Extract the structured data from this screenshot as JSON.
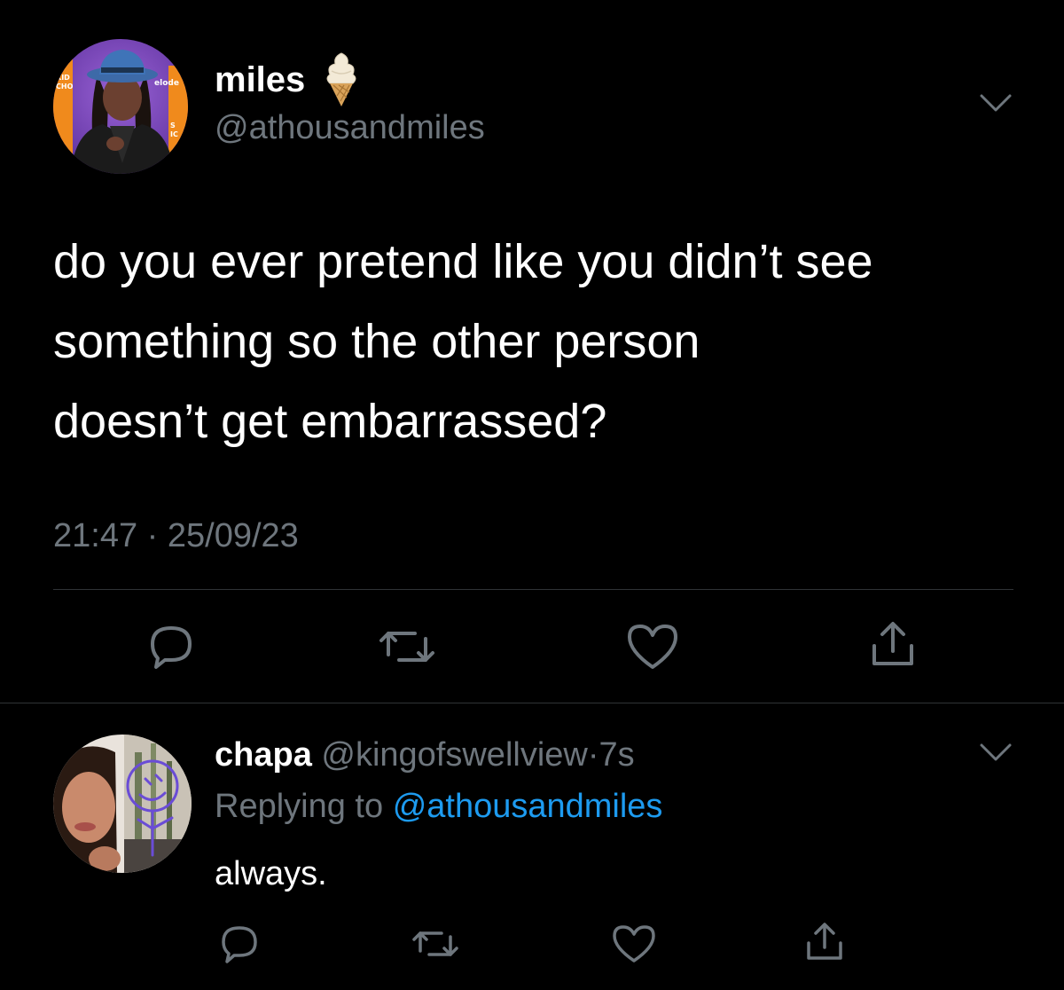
{
  "main_tweet": {
    "display_name": "miles",
    "handle": "@athousandmiles",
    "text": "do you ever pretend like you didn’t see\nsomething so the other person\ndoesn’t get embarrassed?",
    "timestamp": "21:47 · 25/09/23",
    "avatar_background_text": [
      "KID",
      "CHO",
      "elode",
      "S",
      "IC"
    ]
  },
  "reply_tweet": {
    "display_name": "chapa",
    "handle": "@kingofswellview",
    "separator": "·",
    "age": "7s",
    "replying_label": "Replying to",
    "replying_to": "@athousandmiles",
    "text": "always."
  },
  "icons": {
    "name_emoji": "soft-ice-cream-icon",
    "menu": "chevron-down-icon",
    "actions": [
      "reply-icon",
      "retweet-icon",
      "like-icon",
      "share-icon"
    ]
  },
  "colors": {
    "background": "#000000",
    "text": "#ffffff",
    "secondary_text": "#6e767d",
    "divider": "#2f3336",
    "link": "#1d9bf0"
  }
}
